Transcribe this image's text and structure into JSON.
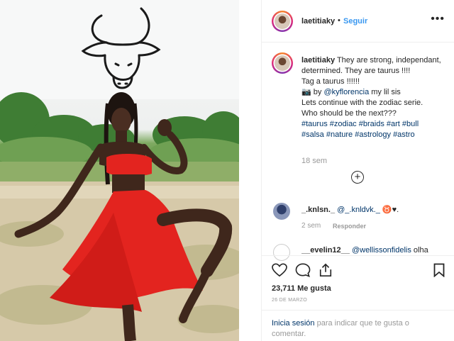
{
  "post": {
    "username": "laetitiaky",
    "separator": "•",
    "follow_label": "Seguir",
    "more_icon": "more-options-icon",
    "caption": {
      "author": "laetitiaky",
      "line1": "They are strong, independant, determined. They are taurus !!!!",
      "line2": "Tag a taurus !!!!!!",
      "line3_prefix": "📷 by ",
      "line3_mention": "@kyflorencia",
      "line3_suffix": " my lil sis",
      "line4": "Lets continue with the zodiac serie.",
      "line5": "Who should be the next???",
      "hashtags": [
        "#taurus",
        "#zodiac",
        "#braids",
        "#art",
        "#bull",
        "#salsa",
        "#nature",
        "#astrology",
        "#astro"
      ]
    },
    "caption_time": "18 sem",
    "load_more_icon": "plus-circle-icon"
  },
  "comments": [
    {
      "username": "_.knlsn._",
      "mention": "@_.knldvk._",
      "text_suffix": " ♉♥.",
      "time": "2 sem",
      "reply_label": "Responder"
    },
    {
      "username": "__evelin12__",
      "mention": "@wellissonfidelis",
      "text_suffix": " olha"
    }
  ],
  "actions": {
    "likes": "23,711 Me gusta",
    "date": "26 DE MARZO",
    "login_link": "Inicia sesión",
    "login_text": " para indicar que te gusta o comentar."
  },
  "colors": {
    "accent": "#3897f0",
    "link": "#003569",
    "muted": "#999999",
    "dress": "#e3241f"
  }
}
